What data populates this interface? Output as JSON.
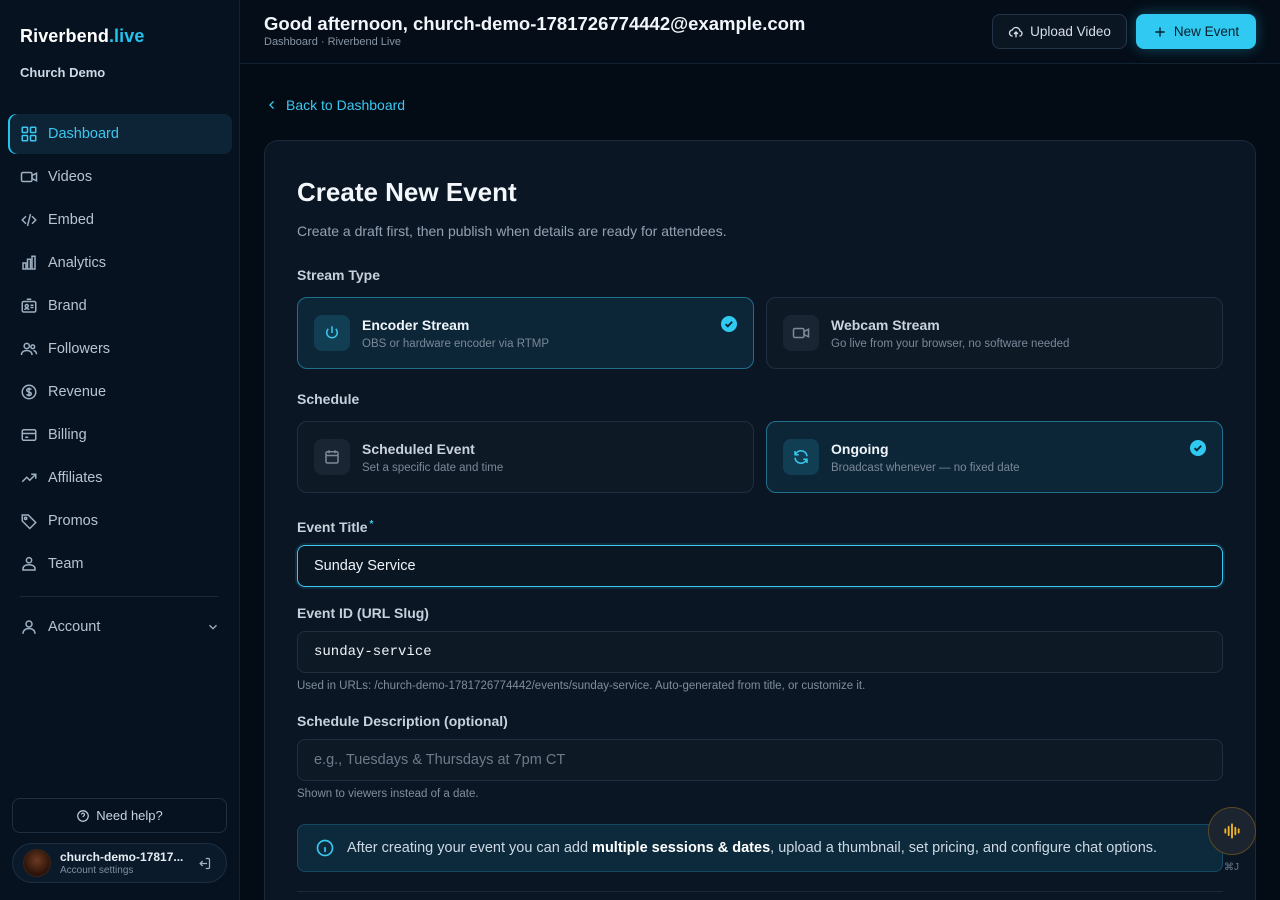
{
  "brand": {
    "name": "Riverbend",
    "accent": ".live",
    "org": "Church Demo"
  },
  "sidebar": {
    "items": [
      {
        "label": "Dashboard",
        "icon": "grid-icon",
        "active": true
      },
      {
        "label": "Videos",
        "icon": "video-icon"
      },
      {
        "label": "Embed",
        "icon": "code-icon"
      },
      {
        "label": "Analytics",
        "icon": "bar-chart-icon"
      },
      {
        "label": "Brand",
        "icon": "brand-icon"
      },
      {
        "label": "Followers",
        "icon": "users-icon"
      },
      {
        "label": "Revenue",
        "icon": "dollar-icon"
      },
      {
        "label": "Billing",
        "icon": "credit-card-icon"
      },
      {
        "label": "Affiliates",
        "icon": "trending-icon"
      },
      {
        "label": "Promos",
        "icon": "tag-icon"
      },
      {
        "label": "Team",
        "icon": "team-icon"
      }
    ],
    "account_label": "Account",
    "help_label": "Need help?",
    "user": {
      "name": "church-demo-17817...",
      "sub": "Account settings"
    }
  },
  "header": {
    "greeting": "Good afternoon, church-demo-1781726774442@example.com",
    "breadcrumb": "Dashboard · Riverbend Live",
    "upload_label": "Upload Video",
    "new_event_label": "New Event"
  },
  "main": {
    "back_label": "Back to Dashboard",
    "title": "Create New Event",
    "subtitle": "Create a draft first, then publish when details are ready for attendees.",
    "stream_type": {
      "label": "Stream Type",
      "options": [
        {
          "title": "Encoder Stream",
          "desc": "OBS or hardware encoder via RTMP",
          "selected": true
        },
        {
          "title": "Webcam Stream",
          "desc": "Go live from your browser, no software needed",
          "selected": false
        }
      ]
    },
    "schedule": {
      "label": "Schedule",
      "options": [
        {
          "title": "Scheduled Event",
          "desc": "Set a specific date and time",
          "selected": false
        },
        {
          "title": "Ongoing",
          "desc": "Broadcast whenever — no fixed date",
          "selected": true
        }
      ]
    },
    "event_title": {
      "label": "Event Title",
      "required_mark": "*",
      "value": "Sunday Service"
    },
    "event_id": {
      "label": "Event ID (URL Slug)",
      "value": "sunday-service",
      "hint": "Used in URLs: /church-demo-1781726774442/events/sunday-service. Auto-generated from title, or customize it."
    },
    "schedule_description": {
      "label": "Schedule Description (optional)",
      "placeholder": "e.g., Tuesdays & Thursdays at 7pm CT",
      "hint": "Shown to viewers instead of a date."
    },
    "info": {
      "prefix": "After creating your event you can add ",
      "bold": "multiple sessions & dates",
      "suffix": ", upload a thumbnail, set pricing, and configure chat options."
    }
  },
  "widget": {
    "shortcut": "⌘J"
  },
  "colors": {
    "accent": "#2fc9f2",
    "background": "#030b15",
    "card": "#0a1624",
    "fab_icon": "#f0b429"
  }
}
